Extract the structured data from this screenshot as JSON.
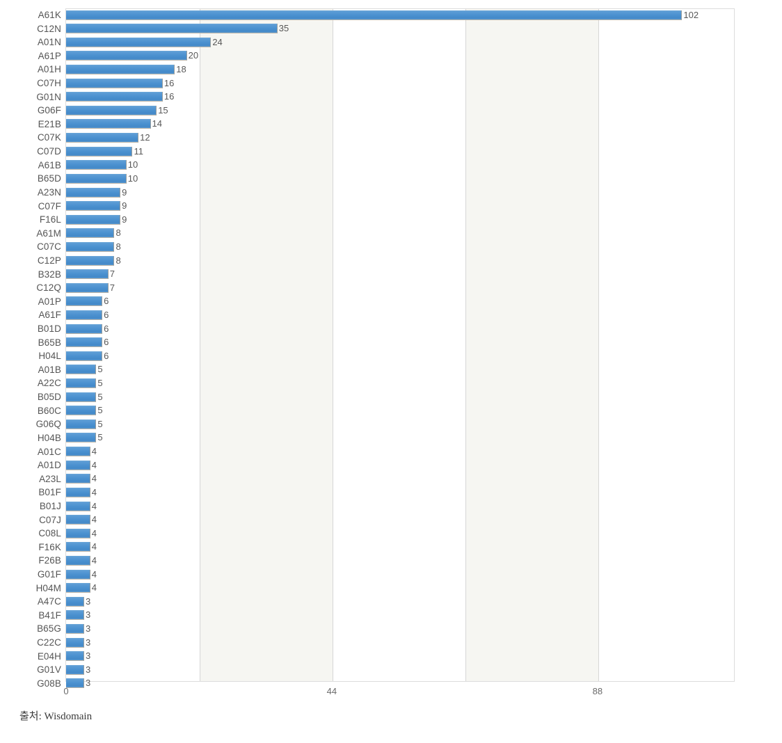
{
  "chart_data": {
    "type": "bar",
    "orientation": "horizontal",
    "title": "",
    "subtitle": "",
    "xlabel": "",
    "ylabel": "",
    "xlim": [
      0,
      110.8
    ],
    "xticks": [
      0,
      44,
      88
    ],
    "xtick_labels": [
      "0",
      "44",
      "88"
    ],
    "gridlines": [
      22,
      44,
      66,
      88
    ],
    "grid": true,
    "legend": null,
    "bar_color": "#4a90cf",
    "band_color": "#f6f6f2",
    "plot_background": "#ffffff",
    "border_color": "#dcdcdc",
    "value_label_color": "#585858",
    "category_label_color": "#555555",
    "categories": [
      "A61K",
      "C12N",
      "A01N",
      "A61P",
      "A01H",
      "C07H",
      "G01N",
      "G06F",
      "E21B",
      "C07K",
      "C07D",
      "A61B",
      "B65D",
      "A23N",
      "C07F",
      "F16L",
      "A61M",
      "C07C",
      "C12P",
      "B32B",
      "C12Q",
      "A01P",
      "A61F",
      "B01D",
      "B65B",
      "H04L",
      "A01B",
      "A22C",
      "B05D",
      "B60C",
      "G06Q",
      "H04B",
      "A01C",
      "A01D",
      "A23L",
      "B01F",
      "B01J",
      "C07J",
      "C08L",
      "F16K",
      "F26B",
      "G01F",
      "H04M",
      "A47C",
      "B41F",
      "B65G",
      "C22C",
      "E04H",
      "G01V",
      "G08B"
    ],
    "values": [
      102,
      35,
      24,
      20,
      18,
      16,
      16,
      15,
      14,
      12,
      11,
      10,
      10,
      9,
      9,
      9,
      8,
      8,
      8,
      7,
      7,
      6,
      6,
      6,
      6,
      6,
      5,
      5,
      5,
      5,
      5,
      5,
      4,
      4,
      4,
      4,
      4,
      4,
      4,
      4,
      4,
      4,
      4,
      3,
      3,
      3,
      3,
      3,
      3,
      3
    ]
  },
  "footer": {
    "source_text": "출처: Wisdomain"
  }
}
